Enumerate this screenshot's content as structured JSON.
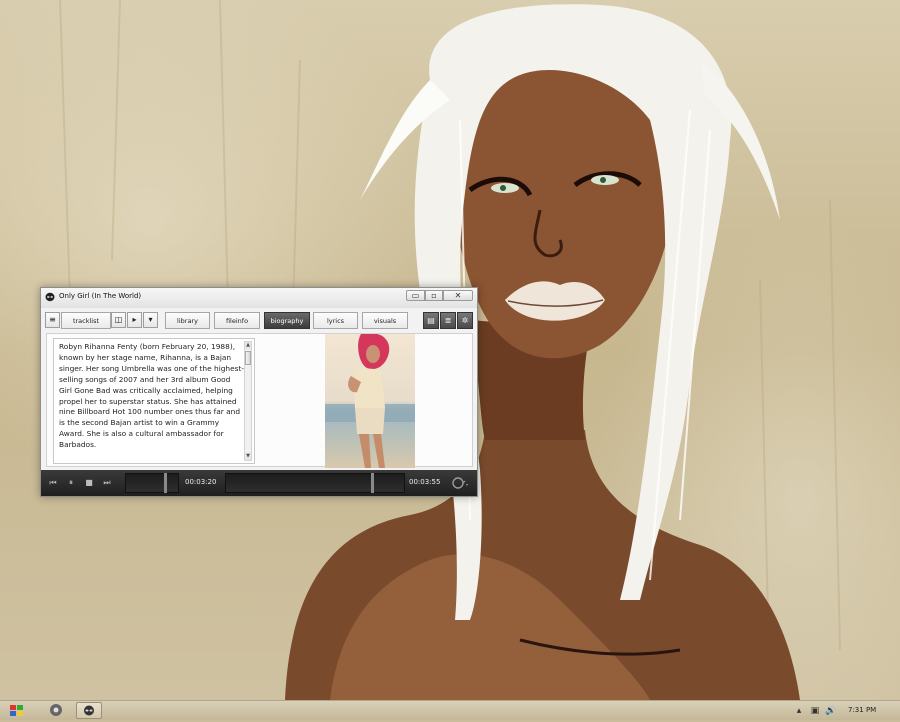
{
  "window": {
    "title": "Only Girl (In The World)",
    "controls": {
      "minimize": "▭",
      "maximize": "▫",
      "close": "✕"
    }
  },
  "toolbar": {
    "tabs": [
      {
        "label": "tracklist",
        "active": false
      },
      {
        "label": "library",
        "active": false
      },
      {
        "label": "fileinfo",
        "active": false
      },
      {
        "label": "biography",
        "active": true
      },
      {
        "label": "lyrics",
        "active": false
      },
      {
        "label": "visuals",
        "active": false
      }
    ]
  },
  "biography": {
    "text": "Robyn Rihanna Fenty (born February 20, 1988), known by her stage name, Rihanna, is a Bajan singer.  Her song Umbrella was one of the highest-selling songs of 2007 and her 3rd album Good Girl Gone Bad was critically acclaimed, helping propel her to superstar status. She has attained nine Billboard Hot 100 number ones thus far and is the second Bajan artist to win a Grammy Award. She is also a cultural ambassador for Barbados."
  },
  "playback": {
    "elapsed": "00:03:20",
    "total": "00:03:55"
  },
  "taskbar": {
    "clock": "7:31 PM"
  },
  "colors": {
    "active_tab": "#3c3c3c",
    "transport_bg": "#262626",
    "wallpaper": "#c9bd9c"
  }
}
